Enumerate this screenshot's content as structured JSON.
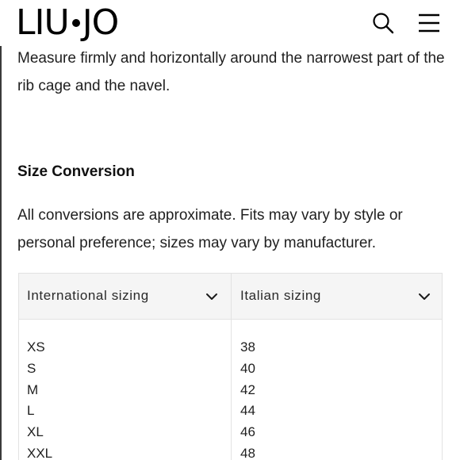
{
  "header": {
    "logo_left": "LIU",
    "logo_right": "JO",
    "search_icon": "search-icon",
    "menu_icon": "hamburger-menu-icon"
  },
  "content": {
    "measure_text": "Measure firmly and horizontally around the narrowest part of the rib cage and the navel.",
    "section_title": "Size Conversion",
    "disclaimer": "All conversions are approximate. Fits may vary by style or personal preference; sizes may vary by manufacturer."
  },
  "size_table": {
    "columns": [
      {
        "label": "International sizing",
        "icon": "chevron-down-icon"
      },
      {
        "label": "Italian sizing",
        "icon": "chevron-down-icon"
      }
    ],
    "rows": [
      {
        "international": "XS",
        "italian": "38"
      },
      {
        "international": "S",
        "italian": "40"
      },
      {
        "international": "M",
        "italian": "42"
      },
      {
        "international": "L",
        "italian": "44"
      },
      {
        "international": "XL",
        "italian": "46"
      },
      {
        "international": "XXL",
        "italian": "48"
      }
    ]
  }
}
